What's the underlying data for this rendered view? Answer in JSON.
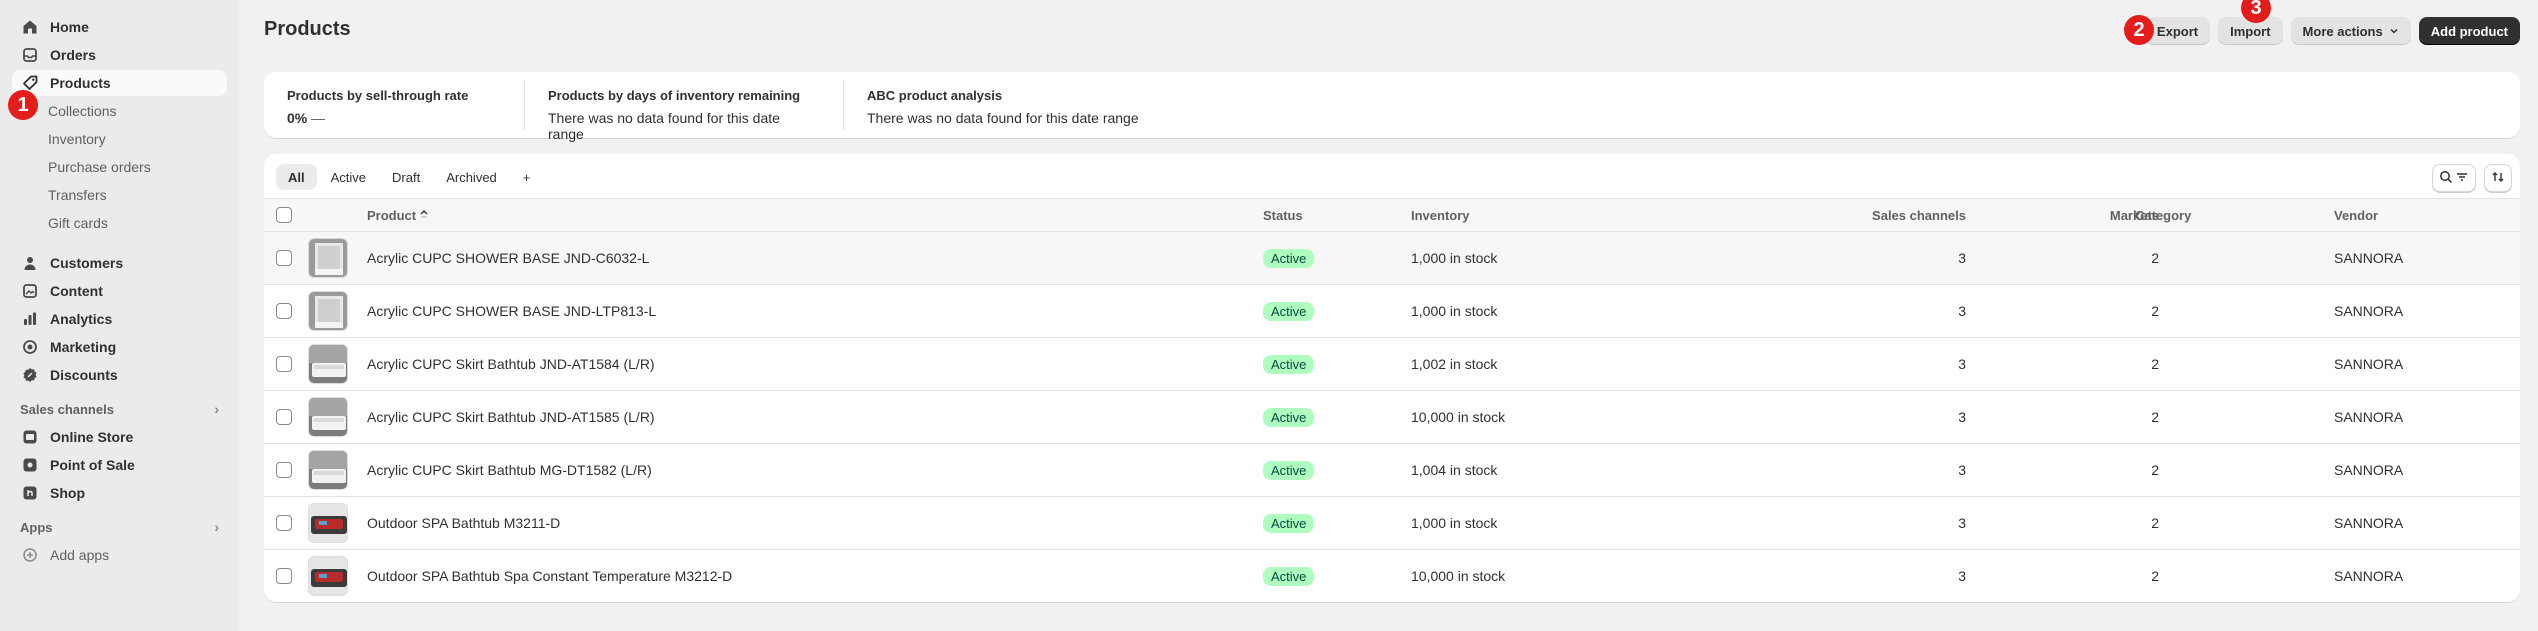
{
  "sidebar": {
    "main_items": [
      {
        "label": "Home",
        "icon": "home-icon"
      },
      {
        "label": "Orders",
        "icon": "inbox-icon"
      },
      {
        "label": "Products",
        "icon": "tag-icon"
      }
    ],
    "product_subitems": [
      "Collections",
      "Inventory",
      "Purchase orders",
      "Transfers",
      "Gift cards"
    ],
    "secondary_items": [
      {
        "label": "Customers",
        "icon": "person-icon"
      },
      {
        "label": "Content",
        "icon": "image-icon"
      },
      {
        "label": "Analytics",
        "icon": "chart-icon"
      },
      {
        "label": "Marketing",
        "icon": "target-icon"
      },
      {
        "label": "Discounts",
        "icon": "discount-icon"
      }
    ],
    "sales_channels_label": "Sales channels",
    "channels": [
      {
        "label": "Online Store",
        "icon": "store-icon"
      },
      {
        "label": "Point of Sale",
        "icon": "pos-icon"
      },
      {
        "label": "Shop",
        "icon": "shop-icon"
      }
    ],
    "apps_label": "Apps",
    "add_apps_label": "Add apps"
  },
  "annotations": [
    "1",
    "2",
    "3"
  ],
  "header": {
    "title": "Products",
    "export_label": "Export",
    "import_label": "Import",
    "more_actions_label": "More actions",
    "add_product_label": "Add product"
  },
  "analytics": [
    {
      "title": "Products by sell-through rate",
      "value": "0%",
      "suffix": "—"
    },
    {
      "title": "Products by days of inventory remaining",
      "value": "There was no data found for this date range"
    },
    {
      "title": "ABC product analysis",
      "value": "There was no data found for this date range"
    }
  ],
  "tabs": [
    "All",
    "Active",
    "Draft",
    "Archived",
    "+"
  ],
  "columns": {
    "product": "Product",
    "status": "Status",
    "inventory": "Inventory",
    "sales_channels": "Sales channels",
    "markets": "Markets",
    "category": "Category",
    "vendor": "Vendor"
  },
  "rows": [
    {
      "product": "Acrylic CUPC SHOWER BASE JND-C6032-L",
      "status": "Active",
      "inventory": "1,000 in stock",
      "sales_channels": "3",
      "markets": "2",
      "category": "",
      "vendor": "SANNORA"
    },
    {
      "product": "Acrylic CUPC SHOWER BASE JND-LTP813-L",
      "status": "Active",
      "inventory": "1,000 in stock",
      "sales_channels": "3",
      "markets": "2",
      "category": "",
      "vendor": "SANNORA"
    },
    {
      "product": "Acrylic CUPC Skirt Bathtub JND-AT1584 (L/R)",
      "status": "Active",
      "inventory": "1,002 in stock",
      "sales_channels": "3",
      "markets": "2",
      "category": "",
      "vendor": "SANNORA"
    },
    {
      "product": "Acrylic CUPC Skirt Bathtub JND-AT1585 (L/R)",
      "status": "Active",
      "inventory": "10,000 in stock",
      "sales_channels": "3",
      "markets": "2",
      "category": "",
      "vendor": "SANNORA"
    },
    {
      "product": "Acrylic CUPC Skirt Bathtub MG-DT1582 (L/R)",
      "status": "Active",
      "inventory": "1,004 in stock",
      "sales_channels": "3",
      "markets": "2",
      "category": "",
      "vendor": "SANNORA"
    },
    {
      "product": "Outdoor SPA Bathtub M3211-D",
      "status": "Active",
      "inventory": "1,000 in stock",
      "sales_channels": "3",
      "markets": "2",
      "category": "",
      "vendor": "SANNORA"
    },
    {
      "product": "Outdoor SPA Bathtub Spa Constant Temperature M3212-D",
      "status": "Active",
      "inventory": "10,000 in stock",
      "sales_channels": "3",
      "markets": "2",
      "category": "",
      "vendor": "SANNORA"
    }
  ],
  "colors": {
    "accent_dark": "#303030",
    "badge_active_bg": "#affebf",
    "annotation_red": "#e51c1c"
  }
}
